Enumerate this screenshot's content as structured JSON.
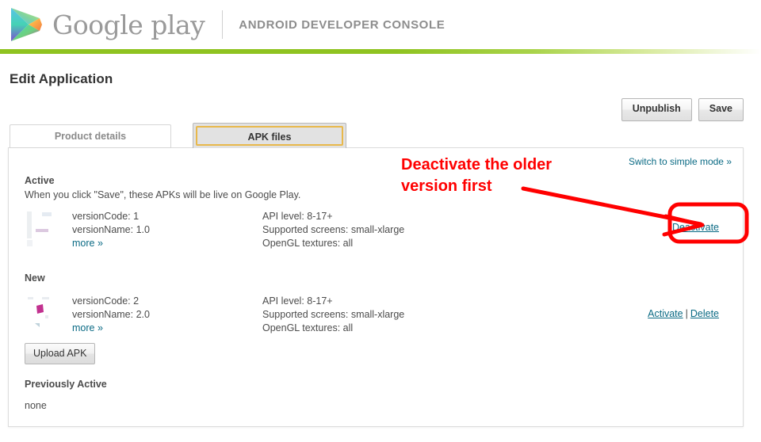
{
  "header": {
    "wordmark": "Google play",
    "console_label": "ANDROID DEVELOPER CONSOLE",
    "logo_icon": "google-play-triangle-icon"
  },
  "page": {
    "title": "Edit Application"
  },
  "top_actions": {
    "unpublish_label": "Unpublish",
    "save_label": "Save"
  },
  "tabs": [
    {
      "label": "Product details",
      "active": false
    },
    {
      "label": "APK files",
      "active": true
    }
  ],
  "panel": {
    "switch_mode_link": "Switch to simple mode »",
    "active_section": {
      "heading": "Active",
      "subtext": "When you click \"Save\", these APKs will be live on Google Play.",
      "apk": {
        "version_code": "versionCode: 1",
        "version_name": "versionName: 1.0",
        "more_link": "more »",
        "api_level": "API level: 8-17+",
        "supported_screens": "Supported screens: small-xlarge",
        "opengl_textures": "OpenGL textures: all",
        "action_primary": "Deactivate"
      }
    },
    "new_section": {
      "heading": "New",
      "apk": {
        "version_code": "versionCode: 2",
        "version_name": "versionName: 2.0",
        "more_link": "more »",
        "api_level": "API level: 8-17+",
        "supported_screens": "Supported screens: small-xlarge",
        "opengl_textures": "OpenGL textures: all",
        "action_activate": "Activate",
        "action_separator": "|",
        "action_delete": "Delete"
      },
      "upload_button": "Upload APK"
    },
    "previously_active_section": {
      "heading": "Previously Active",
      "value": "none"
    }
  },
  "annotation": {
    "text": "Deactivate the older\nversion first",
    "color": "#ff0000"
  },
  "colors": {
    "brand_green": "#8fc320",
    "link_teal": "#0a6a84",
    "tab_accent": "#e8b84b",
    "annotation_red": "#ff0000"
  }
}
